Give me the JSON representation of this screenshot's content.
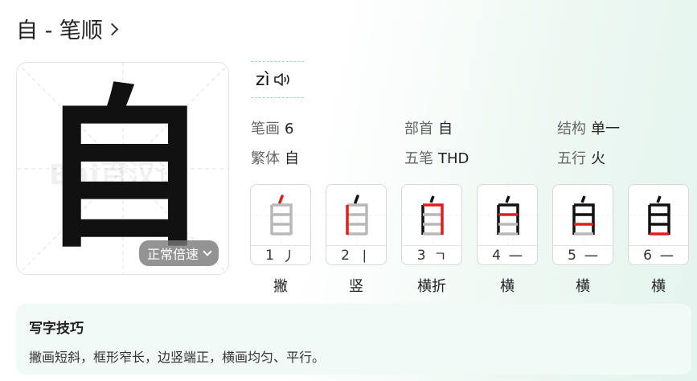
{
  "header": {
    "title": "自 - 笔顺"
  },
  "character": {
    "glyph": "自",
    "watermark": "Bai百汉语",
    "speed_button": "正常倍速"
  },
  "pinyin": {
    "text": "zì",
    "speaker_icon": "speaker-icon"
  },
  "info": {
    "strokes": {
      "label": "笔画",
      "value": "6"
    },
    "radical": {
      "label": "部首",
      "value": "自"
    },
    "structure": {
      "label": "结构",
      "value": "单一"
    },
    "traditional": {
      "label": "繁体",
      "value": "自"
    },
    "wubi": {
      "label": "五笔",
      "value": "THD"
    },
    "wuxing": {
      "label": "五行",
      "value": "火"
    }
  },
  "strokes": [
    {
      "num": "1",
      "sym": "丿",
      "name": "撇"
    },
    {
      "num": "2",
      "sym": "丨",
      "name": "竖"
    },
    {
      "num": "3",
      "sym": "ㄱ",
      "name": "横折"
    },
    {
      "num": "4",
      "sym": "一",
      "name": "横"
    },
    {
      "num": "5",
      "sym": "一",
      "name": "横"
    },
    {
      "num": "6",
      "sym": "一",
      "name": "横"
    }
  ],
  "tips": {
    "title": "写字技巧",
    "text": "撇画短斜，框形窄长，边竖端正，横画均匀、平行。"
  },
  "colors": {
    "highlight": "#e21b1b",
    "drawn": "#111111",
    "pending": "#b8b8b8",
    "accent": "#9fd6c9"
  }
}
